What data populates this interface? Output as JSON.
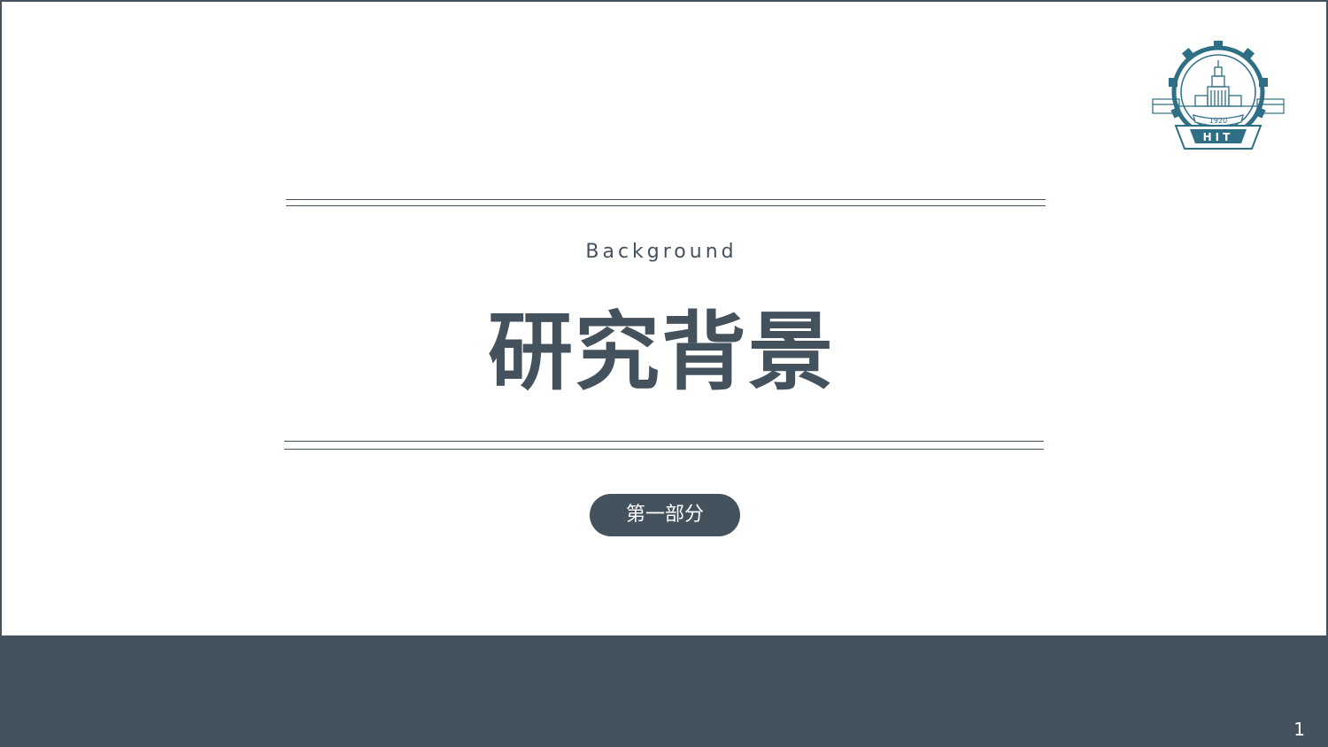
{
  "slide": {
    "subtitle": "Background",
    "title": "研究背景",
    "section_badge": "第一部分",
    "page_number": "1"
  },
  "logo": {
    "icon": "hit-university-emblem-icon",
    "year_text": "1920",
    "initials_text": "HIT"
  },
  "colors": {
    "primary": "#44525e",
    "background": "#ffffff",
    "emblem": "#2f6f86"
  }
}
